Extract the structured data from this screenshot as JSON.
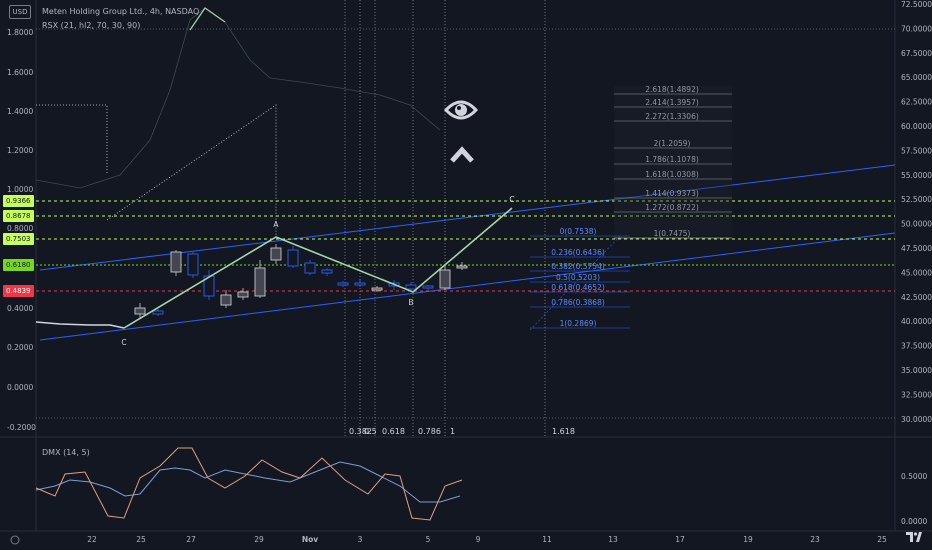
{
  "currency_badge": "USD",
  "legend": {
    "title": "Meten Holding Group Ltd., 4h, NASDAQ",
    "indicator": "RSX (21, hl2, 70, 30, 90)",
    "lower_indicator": "DMX (14, 5)"
  },
  "left_axis": [
    "1.8000",
    "1.6000",
    "1.4000",
    "1.2000",
    "1.0000",
    "0.8000",
    "0.6000",
    "0.4000",
    "0.2000",
    "0.0000",
    "-0.2000"
  ],
  "right_axis": [
    "72.5000",
    "70.0000",
    "67.5000",
    "65.0000",
    "62.5000",
    "60.0000",
    "57.5000",
    "55.0000",
    "52.5000",
    "50.0000",
    "47.5000",
    "45.0000",
    "42.5000",
    "40.0000",
    "37.5000",
    "35.0000",
    "32.5000",
    "30.0000"
  ],
  "dmx_axis": [
    "0.5000",
    "0.0000"
  ],
  "price_labels": [
    {
      "text": "0.9366",
      "color": "#c6ff5a"
    },
    {
      "text": "0.8678",
      "color": "#c6ff5a"
    },
    {
      "text": "0.7503",
      "color": "#c6ff5a"
    },
    {
      "text": "0.6180",
      "color": "#76d81c"
    },
    {
      "text": "0.4839",
      "color": "#f23645"
    }
  ],
  "time_axis": [
    "22",
    "25",
    "27",
    "29",
    "Nov",
    "3",
    "5",
    "9",
    "11",
    "13",
    "17",
    "19",
    "23",
    "25"
  ],
  "fib_time_labels": [
    "0.382",
    "0.5",
    "0.618",
    "0.786",
    "1",
    "1.618"
  ],
  "fib_extension_labels": [
    "2.618(1.4892)",
    "2.414(1.3957)",
    "2.272(1.3306)",
    "2(1.2059)",
    "1.786(1.1078)",
    "1.618(1.0308)",
    "1.414(0.9373)",
    "1.272(0.8722)",
    "1(0.7475)"
  ],
  "fib_retracement_labels": [
    "0(0.7538)",
    "0.236(0.6436)",
    "0.382(0.5754)",
    "0.5(0.5203)",
    "0.618(0.4652)",
    "0.786(0.3868)",
    "1(0.2869)"
  ],
  "pattern_points": [
    "C",
    "A",
    "B",
    "C"
  ],
  "icons": [
    "eye-icon",
    "chevron-up-icon",
    "tradingview-logo-icon",
    "timezone-icon"
  ],
  "colors": {
    "background": "#131722",
    "bull_candle": "#c8c8c8",
    "bear_candle": "#2962ff",
    "pattern_line": "#a5d6a7",
    "trend_line": "#2962ff",
    "red_level": "#f23645",
    "green_level": "#c6ff5a"
  }
}
